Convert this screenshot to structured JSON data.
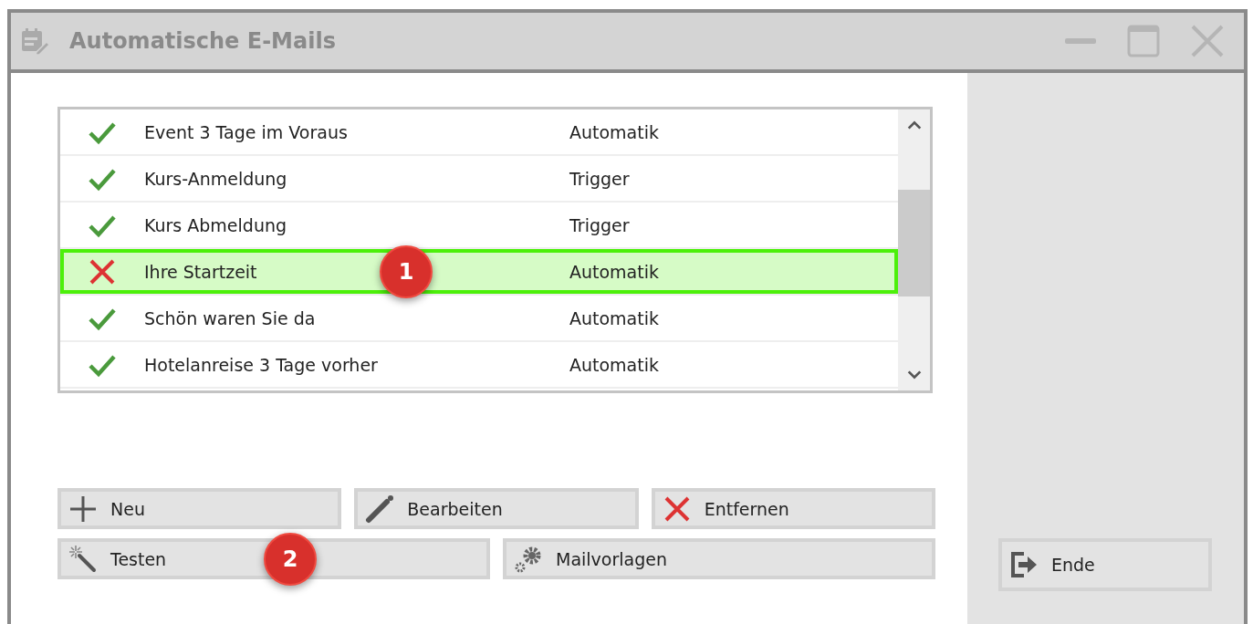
{
  "window": {
    "title": "Automatische E-Mails"
  },
  "list": {
    "rows": [
      {
        "active": true,
        "name": "Event 3 Tage im Voraus",
        "type": "Automatik",
        "selected": false
      },
      {
        "active": true,
        "name": "Kurs-Anmeldung",
        "type": "Trigger",
        "selected": false
      },
      {
        "active": true,
        "name": "Kurs Abmeldung",
        "type": "Trigger",
        "selected": false
      },
      {
        "active": false,
        "name": "Ihre Startzeit",
        "type": "Automatik",
        "selected": true
      },
      {
        "active": true,
        "name": "Schön waren Sie da",
        "type": "Automatik",
        "selected": false
      },
      {
        "active": true,
        "name": "Hotelanreise 3 Tage vorher",
        "type": "Automatik",
        "selected": false
      }
    ]
  },
  "buttons": [
    {
      "kind": "plus",
      "label": "Neu"
    },
    {
      "kind": "pen",
      "label": "Bearbeiten"
    },
    {
      "kind": "cross",
      "label": "Entfernen"
    },
    {
      "kind": "wand",
      "label": "Testen"
    },
    {
      "kind": "gears",
      "label": "Mailvorlagen"
    }
  ],
  "side_button": {
    "label": "Ende"
  },
  "callouts": [
    "1",
    "2"
  ]
}
